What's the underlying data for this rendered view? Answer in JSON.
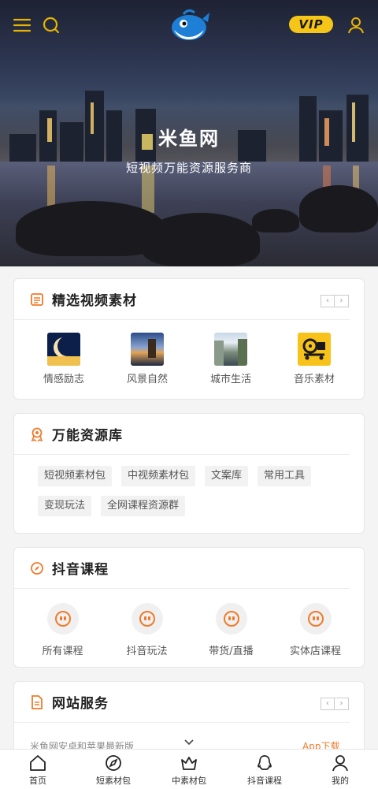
{
  "hero": {
    "title": "米鱼网",
    "subtitle": "短视频万能资源服务商"
  },
  "topbar": {
    "vip_label": "VIP",
    "menu_icon": "menu-icon",
    "search_icon": "search-icon",
    "user_icon": "user-icon",
    "accent": "#f5c518"
  },
  "featured": {
    "title": "精选视频素材",
    "items": [
      {
        "label": "情感励志",
        "icon": "emotion-thumb"
      },
      {
        "label": "风景自然",
        "icon": "landscape-thumb"
      },
      {
        "label": "城市生活",
        "icon": "city-thumb"
      },
      {
        "label": "音乐素材",
        "icon": "music-thumb"
      }
    ]
  },
  "library": {
    "title": "万能资源库",
    "tags": [
      "短视频素材包",
      "中视频素材包",
      "文案库",
      "常用工具",
      "变现玩法",
      "全网课程资源群"
    ]
  },
  "courses": {
    "title": "抖音课程",
    "items": [
      "所有课程",
      "抖音玩法",
      "带货/直播",
      "实体店课程"
    ]
  },
  "services": {
    "title": "网站服务",
    "peek_text": "米鱼网安卓和苹果最新版",
    "peek_button": "App下载"
  },
  "bottom_nav": [
    {
      "label": "首页",
      "icon": "home-icon"
    },
    {
      "label": "短素材包",
      "icon": "compass-icon"
    },
    {
      "label": "中素材包",
      "icon": "crown-icon"
    },
    {
      "label": "抖音课程",
      "icon": "qq-icon"
    },
    {
      "label": "我的",
      "icon": "profile-icon"
    }
  ],
  "colors": {
    "orange": "#f07a2a",
    "gold": "#e8b400"
  }
}
